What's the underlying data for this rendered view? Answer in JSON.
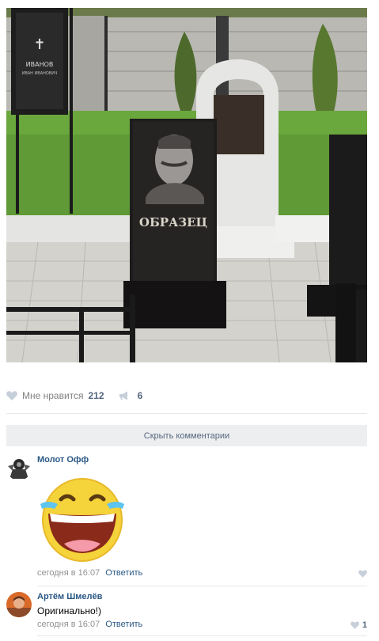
{
  "post": {
    "photo_alt": "Образец памятника с портретом",
    "monument_text": "ОБРАЗЕЦ",
    "sample_grave_name": "ИВАНОВ",
    "sample_grave_subtitle": "ИВАН ИВАНОВИЧ"
  },
  "actions": {
    "like_label": "Мне нравится",
    "like_count": "212",
    "share_count": "6"
  },
  "hide_comments_label": "Скрыть комментарии",
  "comments": [
    {
      "author": "Молот Офф",
      "text": "",
      "time": "сегодня в 16:07",
      "reply_label": "Ответить",
      "likes": ""
    },
    {
      "author": "Артём Шмелёв",
      "text": "Оригинально!)",
      "time": "сегодня в 16:07",
      "reply_label": "Ответить",
      "likes": "1"
    }
  ],
  "icons": {
    "like": "heart-icon",
    "share": "megaphone-icon",
    "sticker": "laughing-emoji-sticker"
  },
  "colors": {
    "link": "#2a5885",
    "muted": "#939393",
    "button_bg": "#edeef0",
    "divider": "#e7e8ec"
  }
}
